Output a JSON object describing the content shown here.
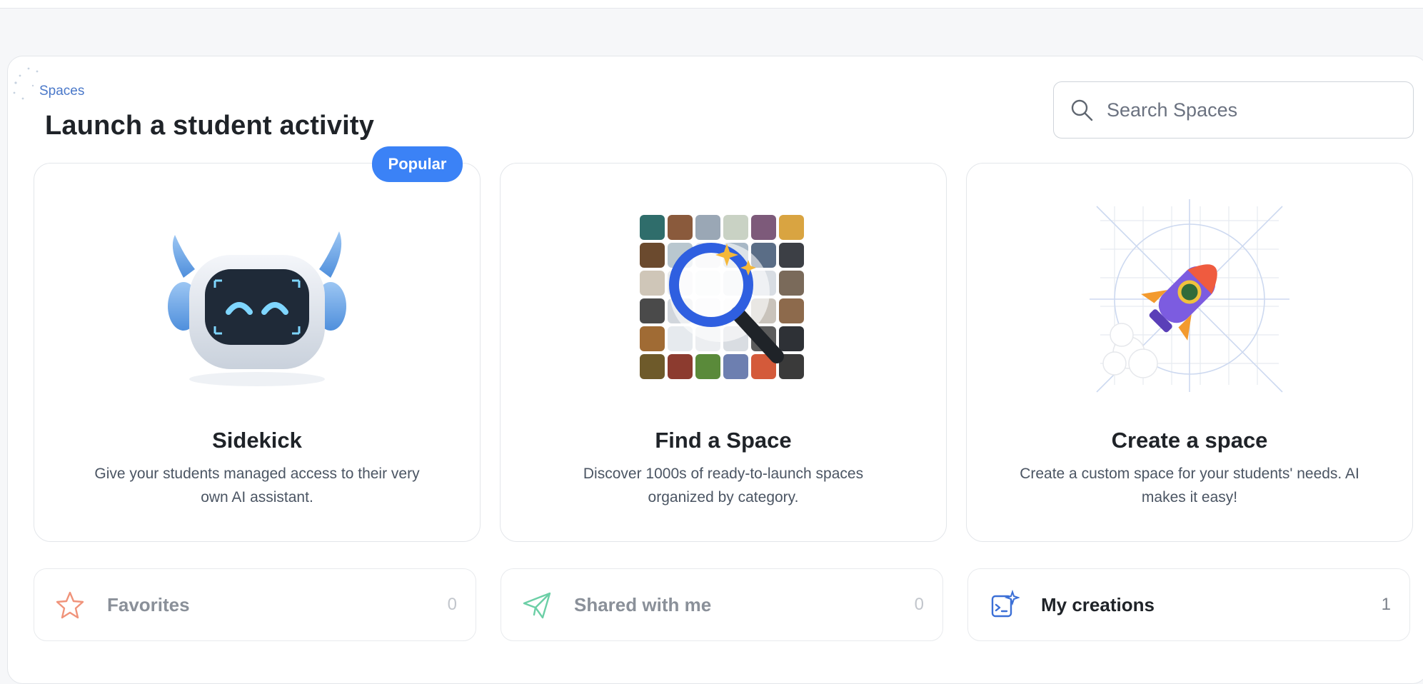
{
  "breadcrumb": "Spaces",
  "page_title": "Launch a student activity",
  "search": {
    "placeholder": "Search Spaces",
    "value": ""
  },
  "cards": [
    {
      "title": "Sidekick",
      "description": "Give your students managed access to their very own AI assistant.",
      "badge": "Popular",
      "icon": "robot-icon"
    },
    {
      "title": "Find a Space",
      "description": "Discover 1000s of ready-to-launch spaces organized by category.",
      "icon": "magnifier-collage-icon"
    },
    {
      "title": "Create a space",
      "description": "Create a custom space for your students' needs. AI makes it easy!",
      "icon": "rocket-icon"
    }
  ],
  "tiles": [
    {
      "label": "Favorites",
      "count": "0",
      "icon": "star-icon",
      "icon_color": "#f0937a"
    },
    {
      "label": "Shared with me",
      "count": "0",
      "icon": "paper-plane-icon",
      "icon_color": "#6ccfa6"
    },
    {
      "label": "My creations",
      "count": "1",
      "icon": "code-sparkle-icon",
      "icon_color": "#3b6fd6"
    }
  ],
  "colors": {
    "accent": "#3b82f6",
    "breadcrumb": "#4a78c9"
  }
}
